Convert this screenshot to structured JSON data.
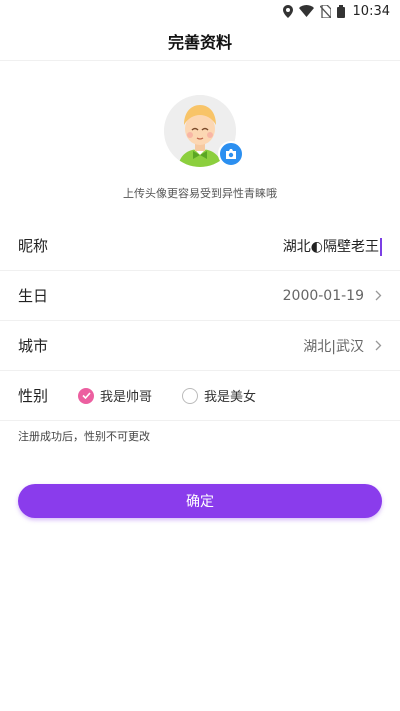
{
  "status_bar": {
    "time": "10:34",
    "icons": [
      "location-icon",
      "wifi-icon",
      "no-sim-icon",
      "battery-icon"
    ]
  },
  "header": {
    "title": "完善资料"
  },
  "avatar": {
    "hint": "上传头像更容易受到异性青睐哦"
  },
  "form": {
    "nickname": {
      "label": "昵称",
      "value": "湖北◐隔壁老王"
    },
    "birthday": {
      "label": "生日",
      "value": "2000-01-19"
    },
    "city": {
      "label": "城市",
      "value": "湖北|武汉"
    },
    "gender": {
      "label": "性别",
      "options": [
        {
          "label": "我是帅哥",
          "checked": true
        },
        {
          "label": "我是美女",
          "checked": false
        }
      ]
    },
    "note": "注册成功后，性别不可更改"
  },
  "confirm": {
    "label": "确定"
  },
  "colors": {
    "accent": "#8a3cec",
    "radio_checked": "#ec5fa0",
    "camera_badge": "#2b8ff0"
  }
}
